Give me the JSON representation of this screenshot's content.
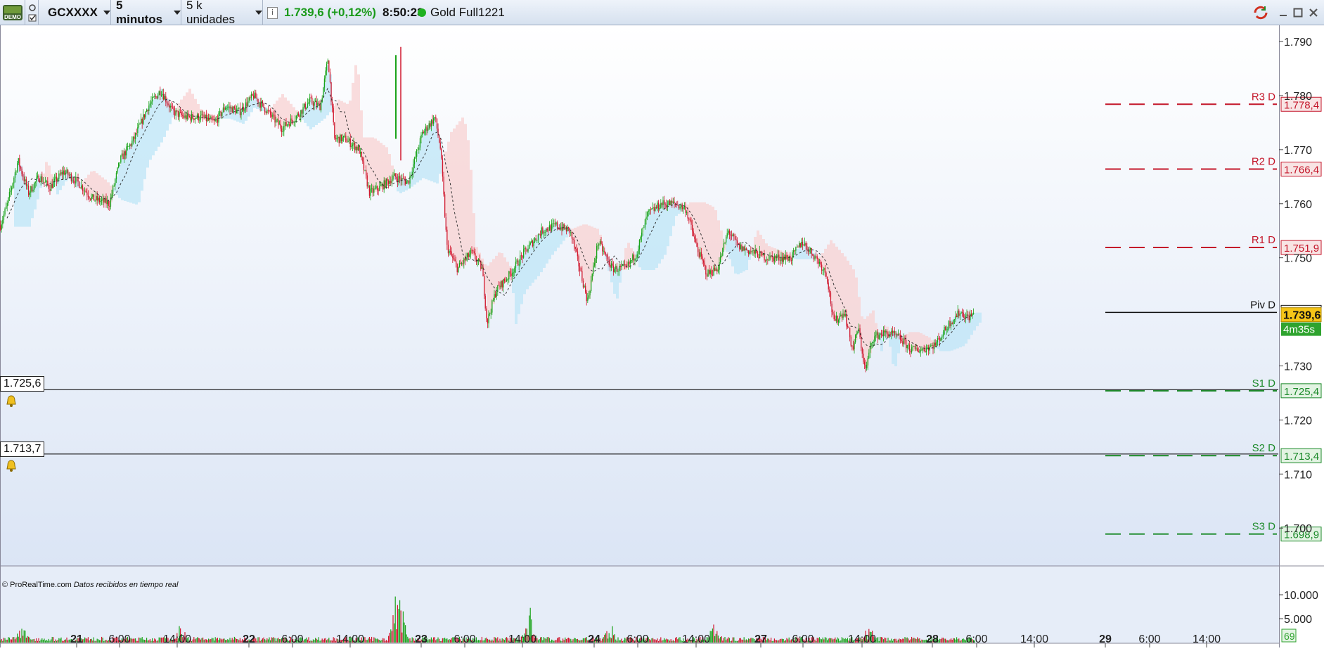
{
  "toolbar": {
    "demo_badge": "DEMO",
    "instrument": "GCXXXX",
    "timeframe": "5 minutos",
    "units": "5 k unidades",
    "info_icon": "i",
    "price_change": "1.739,6 (+0,12%)",
    "time": "8:50:23",
    "contract": "Gold Full1221",
    "icons": [
      "demo-badge-icon",
      "link-icon",
      "checkbox-icon",
      "info-icon",
      "status-dot-icon",
      "sync-icon",
      "minimize-icon",
      "maximize-icon",
      "close-icon"
    ]
  },
  "colors": {
    "bull": "#1aa31a",
    "bear": "#d0182e",
    "resistance": "#c4162a",
    "support": "#1c8a2a",
    "pivot": "#111111",
    "cloud_bull": "#bde6f7",
    "cloud_bear": "#f8d2d2",
    "price_tag": "#f5c518",
    "background_top": "#ffffff",
    "background_bottom": "#dde7f6"
  },
  "chart_data": {
    "type": "candlestick",
    "y_axis": {
      "min": 1693,
      "max": 1793,
      "ticks": [
        "1.790",
        "1.780",
        "1.770",
        "1.760",
        "1.750",
        "1.730",
        "1.720",
        "1.710",
        "1.700"
      ]
    },
    "x_axis": {
      "ticks": [
        "21",
        "6:00",
        "14:00",
        "22",
        "6:00",
        "14:00",
        "23",
        "6:00",
        "14:00",
        "24",
        "6:00",
        "14:00",
        "27",
        "6:00",
        "14:00",
        "28",
        "6:00",
        "14:00",
        "29",
        "6:00",
        "14:00"
      ]
    },
    "close_path": [
      [
        0,
        1756
      ],
      [
        10,
        1760
      ],
      [
        25,
        1768
      ],
      [
        40,
        1762
      ],
      [
        55,
        1765
      ],
      [
        70,
        1763
      ],
      [
        90,
        1766
      ],
      [
        110,
        1764
      ],
      [
        130,
        1761
      ],
      [
        155,
        1760
      ],
      [
        170,
        1768
      ],
      [
        190,
        1772
      ],
      [
        210,
        1778
      ],
      [
        228,
        1781
      ],
      [
        245,
        1777
      ],
      [
        262,
        1776
      ],
      [
        285,
        1776
      ],
      [
        305,
        1775
      ],
      [
        320,
        1778
      ],
      [
        340,
        1777
      ],
      [
        360,
        1780
      ],
      [
        380,
        1777
      ],
      [
        400,
        1774
      ],
      [
        420,
        1776
      ],
      [
        440,
        1779
      ],
      [
        455,
        1778
      ],
      [
        466,
        1787
      ],
      [
        475,
        1772
      ],
      [
        490,
        1772
      ],
      [
        510,
        1770
      ],
      [
        525,
        1762
      ],
      [
        540,
        1763
      ],
      [
        560,
        1765
      ],
      [
        580,
        1764
      ],
      [
        600,
        1773
      ],
      [
        618,
        1776
      ],
      [
        626,
        1770
      ],
      [
        635,
        1752
      ],
      [
        650,
        1748
      ],
      [
        670,
        1751
      ],
      [
        685,
        1748
      ],
      [
        692,
        1738
      ],
      [
        705,
        1744
      ],
      [
        725,
        1747
      ],
      [
        745,
        1751
      ],
      [
        770,
        1755
      ],
      [
        790,
        1756
      ],
      [
        810,
        1755
      ],
      [
        820,
        1750
      ],
      [
        835,
        1742
      ],
      [
        850,
        1753
      ],
      [
        870,
        1748
      ],
      [
        890,
        1748
      ],
      [
        905,
        1751
      ],
      [
        920,
        1758
      ],
      [
        940,
        1760
      ],
      [
        960,
        1760
      ],
      [
        975,
        1759
      ],
      [
        990,
        1752
      ],
      [
        1005,
        1747
      ],
      [
        1020,
        1748
      ],
      [
        1035,
        1755
      ],
      [
        1050,
        1752
      ],
      [
        1070,
        1751
      ],
      [
        1090,
        1750
      ],
      [
        1110,
        1750
      ],
      [
        1125,
        1750
      ],
      [
        1140,
        1753
      ],
      [
        1160,
        1750
      ],
      [
        1175,
        1747
      ],
      [
        1185,
        1738
      ],
      [
        1200,
        1740
      ],
      [
        1212,
        1733
      ],
      [
        1220,
        1737
      ],
      [
        1230,
        1729
      ],
      [
        1240,
        1735
      ],
      [
        1252,
        1736
      ],
      [
        1265,
        1736
      ],
      [
        1280,
        1735
      ],
      [
        1295,
        1733
      ],
      [
        1310,
        1733
      ],
      [
        1330,
        1734
      ],
      [
        1350,
        1738
      ],
      [
        1365,
        1740
      ],
      [
        1375,
        1739
      ],
      [
        1385,
        1739.6
      ]
    ],
    "levels": [
      {
        "name": "R3 D",
        "value": 1778.4,
        "label": "1.778,4",
        "kind": "resistance"
      },
      {
        "name": "R2 D",
        "value": 1766.4,
        "label": "1.766,4",
        "kind": "resistance"
      },
      {
        "name": "R1 D",
        "value": 1751.9,
        "label": "1.751,9",
        "kind": "resistance"
      },
      {
        "name": "Piv D",
        "value": 1739.9,
        "label": "1.739,9",
        "kind": "pivot"
      },
      {
        "name": "S1 D",
        "value": 1725.4,
        "label": "1.725,4",
        "kind": "support"
      },
      {
        "name": "S2 D",
        "value": 1713.4,
        "label": "1.713,4",
        "kind": "support"
      },
      {
        "name": "S3 D",
        "value": 1698.9,
        "label": "1.698,9",
        "kind": "support"
      }
    ],
    "alerts": [
      {
        "value": 1725.6,
        "label": "1.725,6"
      },
      {
        "value": 1713.7,
        "label": "1.713,7"
      }
    ],
    "last_price": {
      "value": 1739.6,
      "label": "1.739,6",
      "countdown": "4m35s"
    },
    "volume": {
      "max": 10000,
      "ticks": [
        "10.000",
        "5.000"
      ],
      "last": "69"
    }
  },
  "footer": {
    "copyright": "© ProRealTime.com",
    "realtime": "Datos recibidos en tiempo real"
  }
}
